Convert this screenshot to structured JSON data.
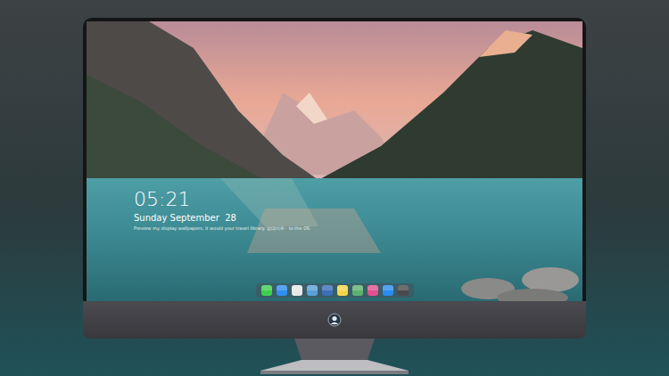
{
  "clock": {
    "time": "05:21",
    "date": "Sunday September  28",
    "message": "Preview my display wallpapers, it would your travel library. 업데이트 · to the OS"
  },
  "dock": {
    "apps": [
      {
        "color": "#3ccf4e"
      },
      {
        "color": "#2f8ef0"
      },
      {
        "color": "#e6e6e6"
      },
      {
        "color": "#5aa0d8"
      },
      {
        "color": "#3a6fb8"
      },
      {
        "color": "#f5d547"
      },
      {
        "color": "#5fb070"
      },
      {
        "color": "#e0508f"
      },
      {
        "color": "#2a8cf0"
      },
      {
        "color": "#4a4a4e"
      }
    ]
  }
}
